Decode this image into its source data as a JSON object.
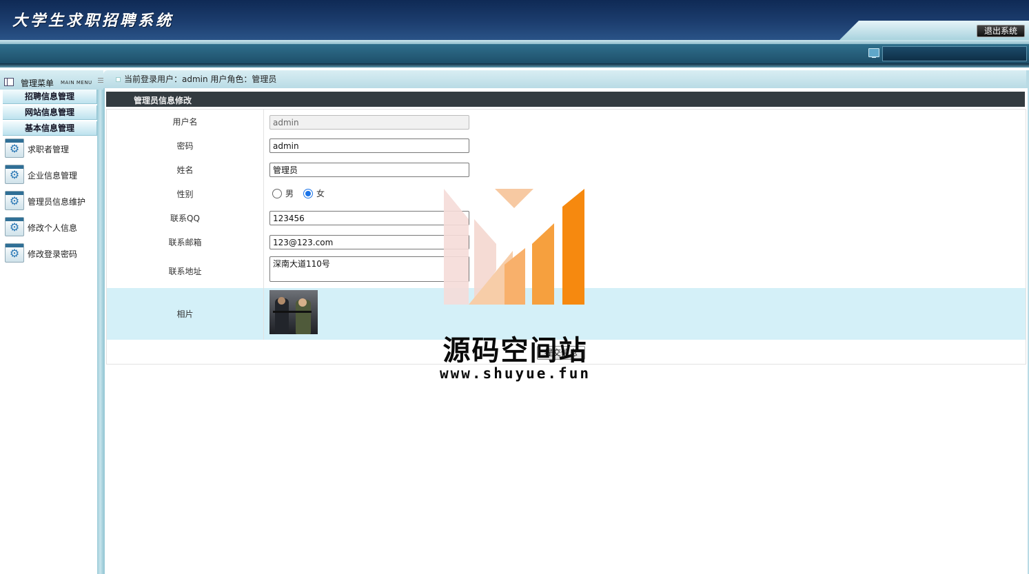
{
  "header": {
    "app_title": "大学生求职招聘系统",
    "logout_label": "退出系统"
  },
  "sidebar": {
    "title": "管理菜单",
    "title_en": "MAIN MENU",
    "categories": [
      {
        "label": "招聘信息管理"
      },
      {
        "label": "网站信息管理"
      },
      {
        "label": "基本信息管理"
      }
    ],
    "links": [
      {
        "label": "求职者管理",
        "icon": "gear-icon"
      },
      {
        "label": "企业信息管理",
        "icon": "gear-icon"
      },
      {
        "label": "管理员信息维护",
        "icon": "gear-icon"
      },
      {
        "label": "修改个人信息",
        "icon": "gear-icon"
      },
      {
        "label": "修改登录密码",
        "icon": "gear-icon"
      }
    ]
  },
  "main": {
    "login_info": "当前登录用户：admin  用户角色：管理员",
    "form_title": "管理员信息修改",
    "fields": {
      "username": {
        "label": "用户名",
        "value": "admin"
      },
      "password": {
        "label": "密码",
        "value": "admin"
      },
      "name": {
        "label": "姓名",
        "value": "管理员"
      },
      "gender": {
        "label": "性别",
        "options": [
          "男",
          "女"
        ],
        "selected": "女"
      },
      "qq": {
        "label": "联系QQ",
        "value": "123456"
      },
      "email": {
        "label": "联系邮箱",
        "value": "123@123.com"
      },
      "address": {
        "label": "联系地址",
        "value": "深南大道110号"
      },
      "photo": {
        "label": "相片"
      }
    },
    "submit_label": "提交信息"
  },
  "watermark": {
    "text": "源码空间站",
    "url": "www.shuyue.fun"
  },
  "colors": {
    "header_dark": "#0f2a55",
    "bar_teal": "#2f6f8c",
    "form_title_bg": "#333b40",
    "photo_row_bg": "#d4f0f8",
    "watermark_orange": "#f6890f"
  }
}
